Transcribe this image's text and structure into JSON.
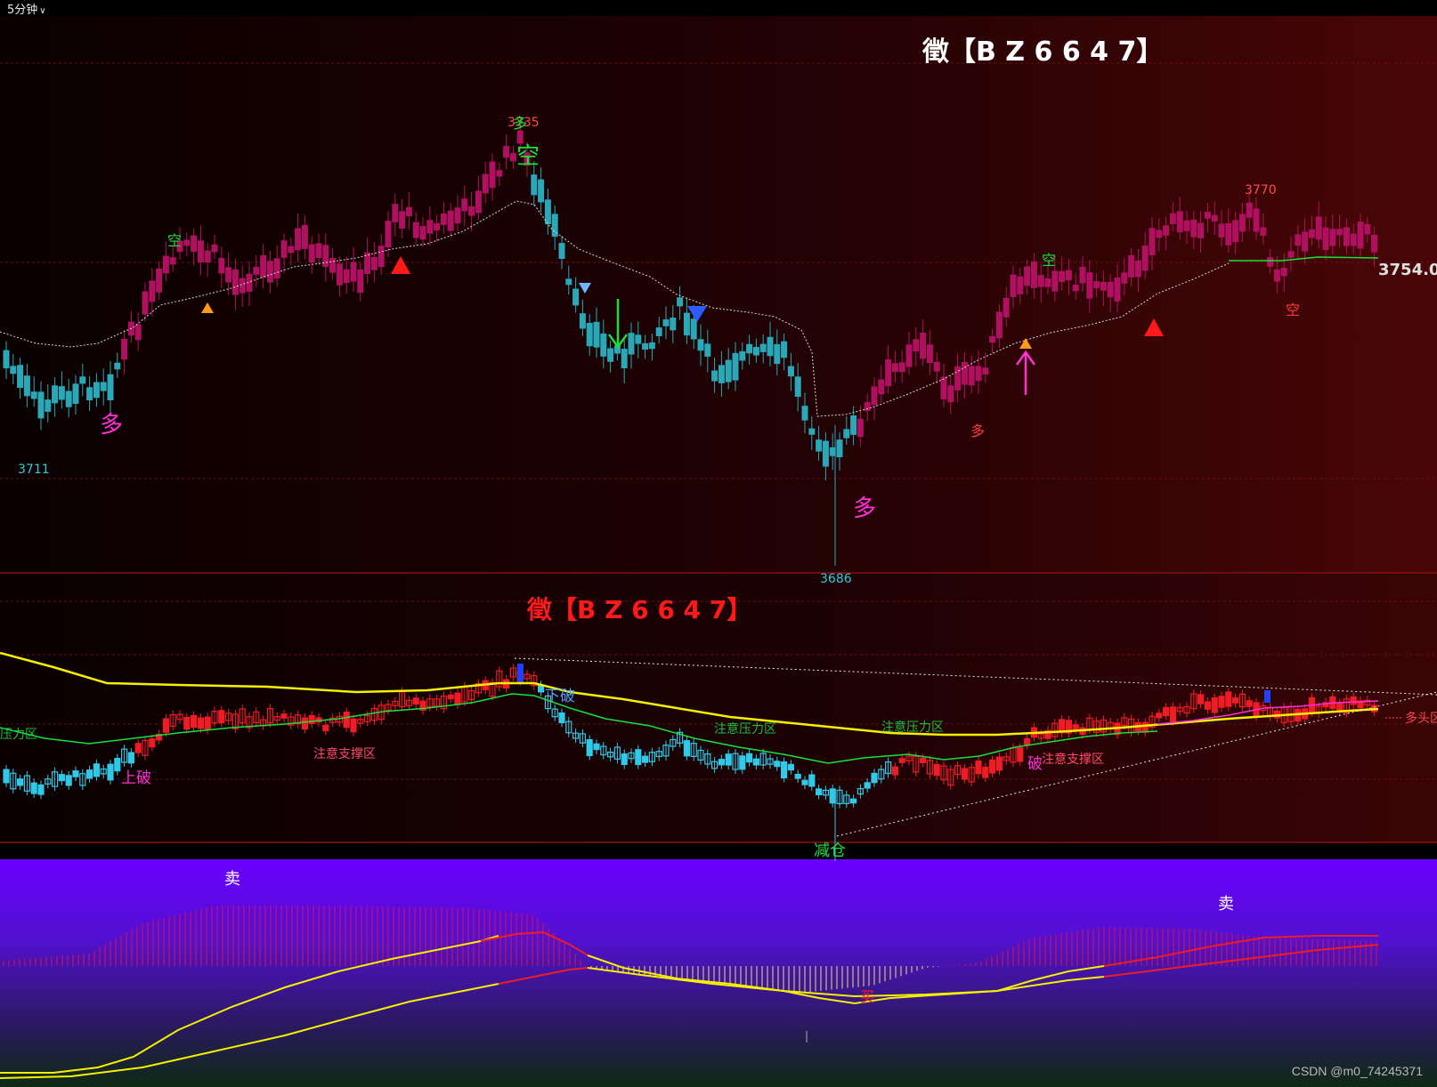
{
  "toolbar": {
    "period": "5分钟"
  },
  "main_panel": {
    "title": "徵【B Z 6 6 4 7】",
    "price_label": "3754.01",
    "high_label_1": "3735",
    "high_label_2": "3770",
    "low_label_1": "3711",
    "low_label_2": "3686",
    "signals": [
      "多",
      "空",
      "多",
      "空",
      "多",
      "多",
      "空",
      "空",
      "多"
    ]
  },
  "mid_panel": {
    "title": "徵【B Z 6 6 4 7】",
    "labels": {
      "pressure_left": "压力区",
      "support_1": "注意支撑区",
      "up_break": "上破",
      "down_break": "下破",
      "pressure_1": "注意压力区",
      "pressure_2": "注意压力区",
      "support_2": "注意支撑区",
      "up_break_2": "破",
      "reduce": "减仓",
      "long_zone": "多头区"
    }
  },
  "bottom_panel": {
    "sell_1": "卖",
    "sell_2": "卖",
    "buy_1": "买"
  },
  "watermark": "CSDN @m0_74245371",
  "colors": {
    "bull": "#ee1c25",
    "bear": "#31c9d8",
    "yellow": "#f5f000",
    "green": "#19e03a",
    "magenta": "#ff2fd8"
  }
}
